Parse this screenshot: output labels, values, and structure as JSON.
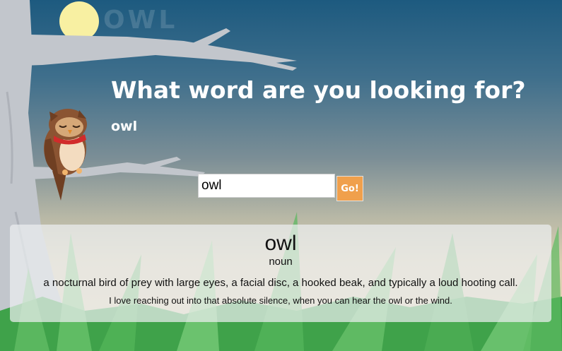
{
  "header": {
    "logo_text": "OWL",
    "title": "What word are you looking for?",
    "searched_word": "owl"
  },
  "search": {
    "value": "owl",
    "button_label": "Go!"
  },
  "result": {
    "word": "owl",
    "part_of_speech": "noun",
    "definition": "a nocturnal bird of prey with large eyes, a facial disc, a hooked beak, and typically a loud hooting call.",
    "example": "I love reaching out into that absolute silence, when you can hear the owl or the wind."
  },
  "colors": {
    "sky_top": "#1d5a7f",
    "moon": "#f8f0a2",
    "tree": "#c2c6cc",
    "grass": "#3fa24a",
    "button": "#f0a04c",
    "owl_body": "#8b5432",
    "scarf": "#d12b2b"
  },
  "icons": [
    "moon-icon",
    "tree-illustration",
    "owl-illustration",
    "grass-illustration"
  ]
}
